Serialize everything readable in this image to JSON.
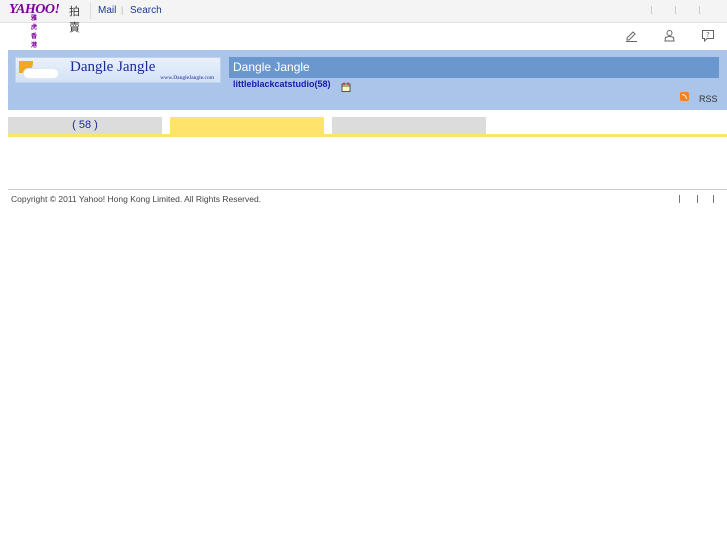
{
  "topbar": {
    "logo_text": "YAHOO!",
    "logo_subtext": "雅虎香港",
    "logo_suffix": "拍賣",
    "links": [
      {
        "label": "Mail"
      },
      {
        "label": "Search"
      }
    ],
    "link_separator": "|"
  },
  "icons": [
    "edit-icon",
    "user-icon",
    "help-icon"
  ],
  "store": {
    "banner_name": "Dangle Jangle",
    "banner_url": "www.DangleJangle.com",
    "title": "Dangle Jangle",
    "seller": "littleblackcatstudio(58)",
    "rss_label": "RSS"
  },
  "tabs": [
    {
      "label": "( 58 )"
    },
    {
      "label": ""
    },
    {
      "label": ""
    }
  ],
  "footer": {
    "copyright": "Copyright © 2011 Yahoo! Hong Kong Limited. All Rights Reserved."
  }
}
